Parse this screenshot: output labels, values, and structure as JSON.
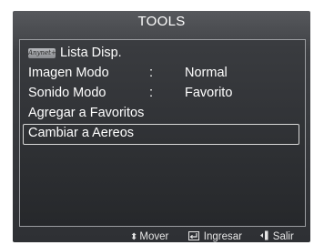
{
  "osd": {
    "title": "TOOLS",
    "menu": [
      {
        "label": "Lista Disp.",
        "logo_text": "Anynet+"
      },
      {
        "label": "Imagen Modo",
        "colon": ":",
        "value": "Normal"
      },
      {
        "label": "Sonido Modo",
        "colon": ":",
        "value": "Favorito"
      },
      {
        "label": "Agregar a Favoritos"
      },
      {
        "label": "Cambiar a Aereos",
        "selected": true
      }
    ],
    "footer": {
      "move_icon": "updown-arrows-icon",
      "move_label": "Mover",
      "enter_icon": "enter-icon",
      "enter_label": "Ingresar",
      "exit_icon": "exit-icon",
      "exit_label": "Salir"
    }
  }
}
